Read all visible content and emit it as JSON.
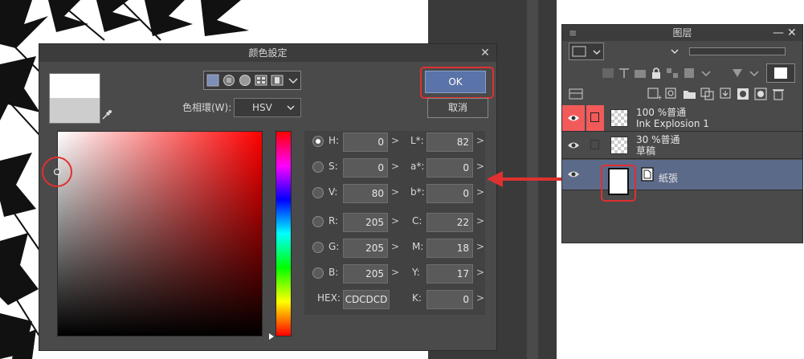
{
  "dialog": {
    "title": "颜色設定",
    "close": "✕",
    "ok_label": "OK",
    "cancel_label": "取消",
    "color_space_label": "色相環(W):",
    "color_space_value": "HSV",
    "current_color": "#ffffff",
    "previous_color": "#cdcdcd",
    "hue_marker_level": 1.0,
    "picker_position": {
      "saturation": 0.0,
      "value": 0.8
    }
  },
  "values": {
    "left": [
      {
        "label": "H:",
        "value": "0",
        "selected": true
      },
      {
        "label": "S:",
        "value": "0",
        "selected": false
      },
      {
        "label": "V:",
        "value": "80",
        "selected": false
      },
      {
        "label": "R:",
        "value": "205",
        "selected": false
      },
      {
        "label": "G:",
        "value": "205",
        "selected": false
      },
      {
        "label": "B:",
        "value": "205",
        "selected": false
      }
    ],
    "hex_label": "HEX:",
    "hex_value": "CDCDCD",
    "right": [
      {
        "label": "L*:",
        "value": "82"
      },
      {
        "label": "a*:",
        "value": "0"
      },
      {
        "label": "b*:",
        "value": "0"
      },
      {
        "label": "C:",
        "value": "22"
      },
      {
        "label": "M:",
        "value": "18"
      },
      {
        "label": "Y:",
        "value": "17"
      },
      {
        "label": "K:",
        "value": "0"
      }
    ],
    "arrow": ">"
  },
  "layers_panel": {
    "title": "图层",
    "menu_icon": "≡",
    "minimize": "—",
    "close": "✕",
    "layers": [
      {
        "line1": "100 %普通",
        "line2": "Ink Explosion 1",
        "selected": false,
        "highlight": "#f25a5a"
      },
      {
        "line1": "30 %普通",
        "line2": "草稿",
        "selected": false,
        "highlight": ""
      },
      {
        "line1": "",
        "line2": "紙張",
        "selected": true,
        "highlight": ""
      }
    ]
  },
  "colors": {
    "accent_red": "#e03030",
    "ok_blue": "#5a73a8",
    "selected_layer": "#5c6a8a"
  }
}
